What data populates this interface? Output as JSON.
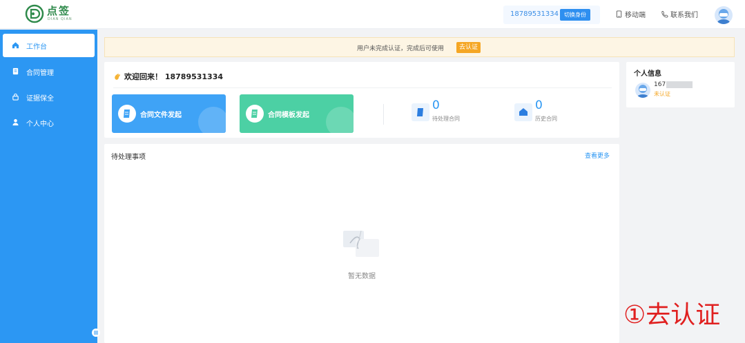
{
  "header": {
    "logo_cn": "点签",
    "logo_en": "DIAN QIAN",
    "phone": "18789531334",
    "switch_identity": "切换身份",
    "mobile": "移动端",
    "contact": "联系我们"
  },
  "sidebar": {
    "items": [
      {
        "label": "工作台",
        "icon": "home-icon"
      },
      {
        "label": "合同管理",
        "icon": "document-icon"
      },
      {
        "label": "证据保全",
        "icon": "lock-icon"
      },
      {
        "label": "个人中心",
        "icon": "user-icon"
      }
    ]
  },
  "notice": {
    "text": "用户未完成认证，完成后可使用",
    "button": "去认证"
  },
  "welcome": {
    "title": "欢迎回来！ 18789531334",
    "action_file": "合同文件发起",
    "action_template": "合同模板发起",
    "stats": [
      {
        "value": "0",
        "label": "待处理合同"
      },
      {
        "value": "0",
        "label": "历史合同"
      }
    ]
  },
  "profile": {
    "title": "个人信息",
    "phone": "167",
    "status": "未认证"
  },
  "pending": {
    "title": "待处理事项",
    "more": "查看更多",
    "empty": "暂无数据"
  },
  "annotation": "①去认证",
  "colors": {
    "primary": "#2c97f3",
    "card_blue": "#3fa3f6",
    "card_green": "#4cd0a4",
    "warning": "#f5a623",
    "annotation": "#e02020"
  }
}
